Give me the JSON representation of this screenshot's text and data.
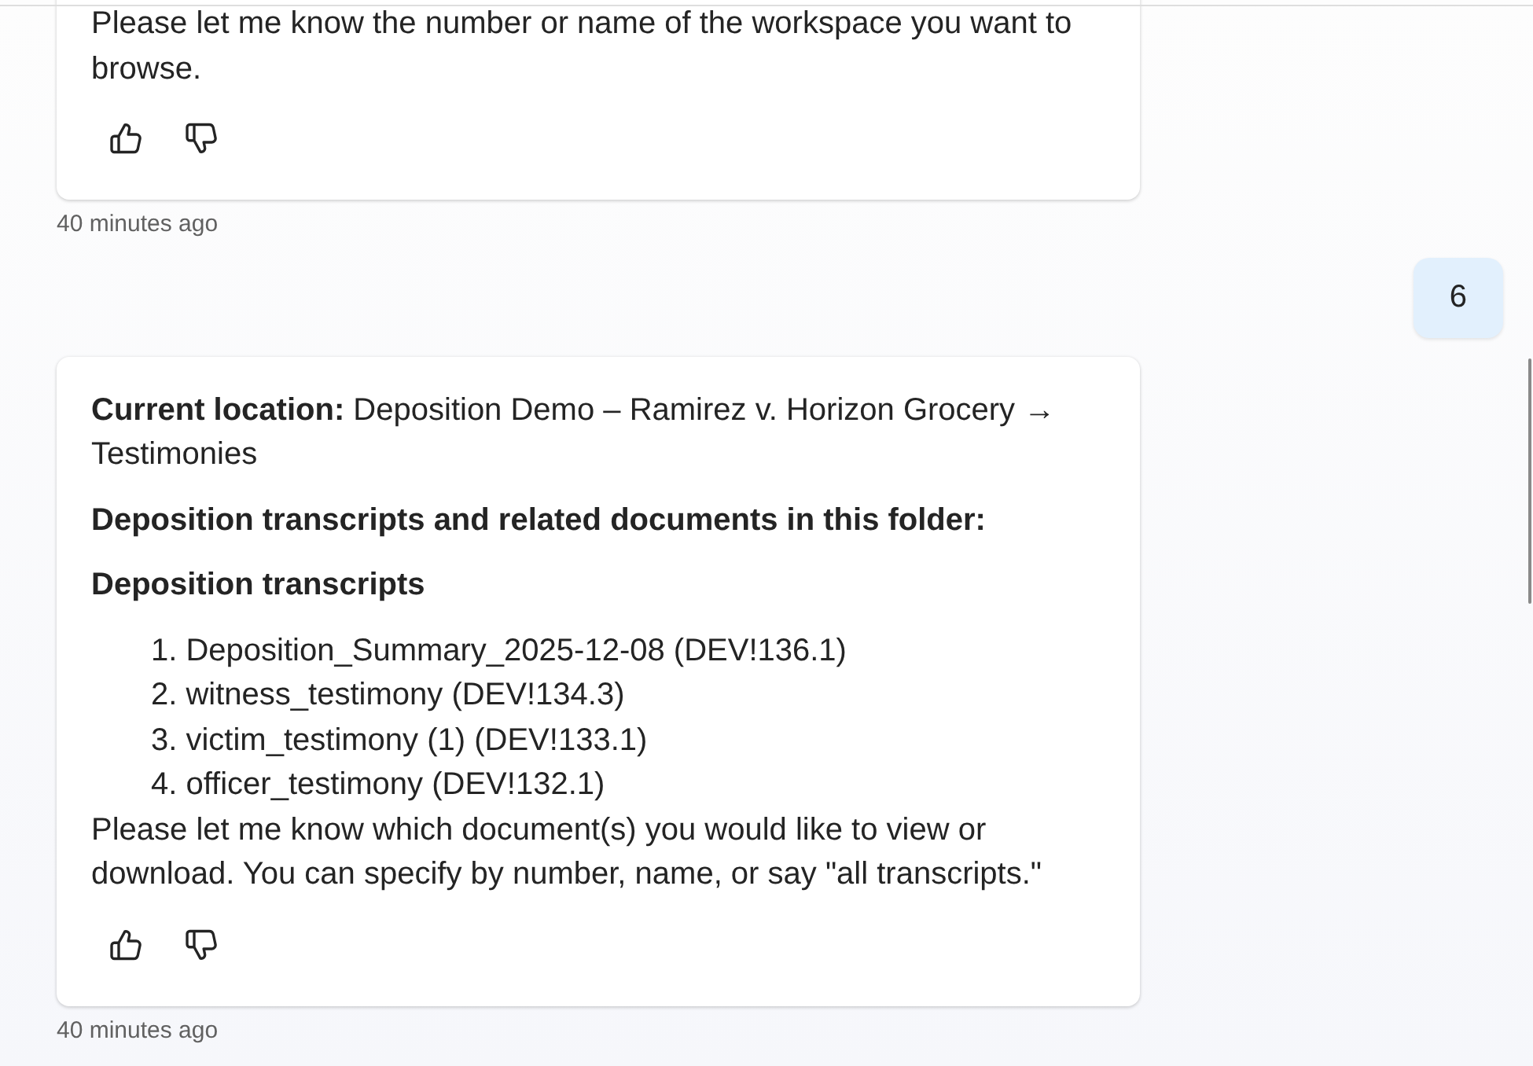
{
  "messages": [
    {
      "kind": "assistant",
      "blocks": [
        {
          "kind": "paragraph",
          "text": "Please let me know the number or name of the workspace you want to browse."
        }
      ],
      "timestamp": "40 minutes ago"
    },
    {
      "kind": "user",
      "text": "6"
    },
    {
      "kind": "assistant",
      "blocks": [
        {
          "kind": "paragraph",
          "text": "**Current location:** Deposition Demo – Ramirez v. Horizon Grocery → Testimonies"
        },
        {
          "kind": "heading",
          "text": "Deposition transcripts and related documents in this folder:"
        },
        {
          "kind": "heading",
          "text": "Deposition transcripts"
        },
        {
          "kind": "list",
          "items": [
            "1. Deposition_Summary_2025-12-08 (DEV!136.1)",
            "2. witness_testimony (DEV!134.3)",
            "3. victim_testimony (1) (DEV!133.1)",
            "4. officer_testimony (DEV!132.1)"
          ]
        },
        {
          "kind": "paragraph",
          "text": "Please let me know which document(s) you would like to view or download. You can specify by number, name, or say \"all transcripts.\""
        }
      ],
      "timestamp": "40 minutes ago"
    }
  ]
}
